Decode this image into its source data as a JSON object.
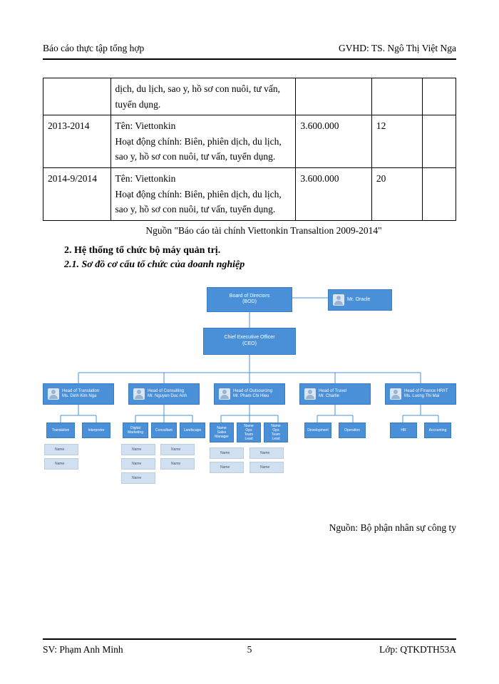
{
  "header": {
    "left": "Báo cáo thực tập tổng hợp",
    "right": "GVHD: TS. Ngô Thị Việt Nga"
  },
  "footer": {
    "left": "SV: Phạm Anh Minh",
    "center": "5",
    "right": "Lớp: QTKDTH53A"
  },
  "table": {
    "rows": [
      {
        "c0": "",
        "c1": "dịch, du lịch, sao y, hồ sơ con nuôi, tư vấn, tuyển dụng.",
        "c2": "",
        "c3": "",
        "c4": ""
      },
      {
        "c0": "2013-2014",
        "c1": "Tên: Viettonkin\nHoạt động chính: Biên, phiên dịch, du lịch, sao y, hồ sơ con nuôi, tư vấn, tuyển dụng.",
        "c2": "3.600.000",
        "c3": "12",
        "c4": ""
      },
      {
        "c0": "2014-9/2014",
        "c1": "Tên: Viettonkin\nHoạt động chính: Biên, phiên dịch, du lịch, sao y, hồ sơ con nuôi, tư vấn, tuyển dụng.",
        "c2": "3.600.000",
        "c3": "20",
        "c4": ""
      }
    ]
  },
  "source_line": "Nguồn \"Báo cáo tài chính Viettonkin Transaltion 2009-2014\"",
  "heading2": "2. Hệ thống tổ chức bộ máy quản trị.",
  "heading3": "2.1. Sơ đồ cơ cấu tổ chức của doanh nghiệp",
  "org": {
    "bod": "Board of Directors\n(BOD)",
    "oracle": "Mr. Oracle",
    "ceo": "Chief Executive Officer\n(CEO)",
    "heads": [
      "Head of Translation\nMs. Dinh Kim Nga",
      "Head of Consulting\nMr. Nguyen Duc Anh",
      "Head of Outsourcing\nMr. Pham Chi Hieu",
      "Head of Travel\nMr. Charlie",
      "Head of Finance HR/IT\nMs. Luong Thi Mai"
    ],
    "subs": {
      "a": [
        "Translation",
        "Interpreter"
      ],
      "b": [
        "Digital Marketing",
        "Consultant",
        "Landscape"
      ],
      "c": [
        "Name\nSales Manager",
        "Name\nOps Team Lead",
        "Name\nOps Team Lead"
      ],
      "d": [
        "Development",
        "Operation"
      ],
      "e": [
        "HR",
        "Accounting"
      ]
    },
    "people_label": "Name"
  },
  "org_source": "Nguồn: Bộ phận nhân sự công ty"
}
